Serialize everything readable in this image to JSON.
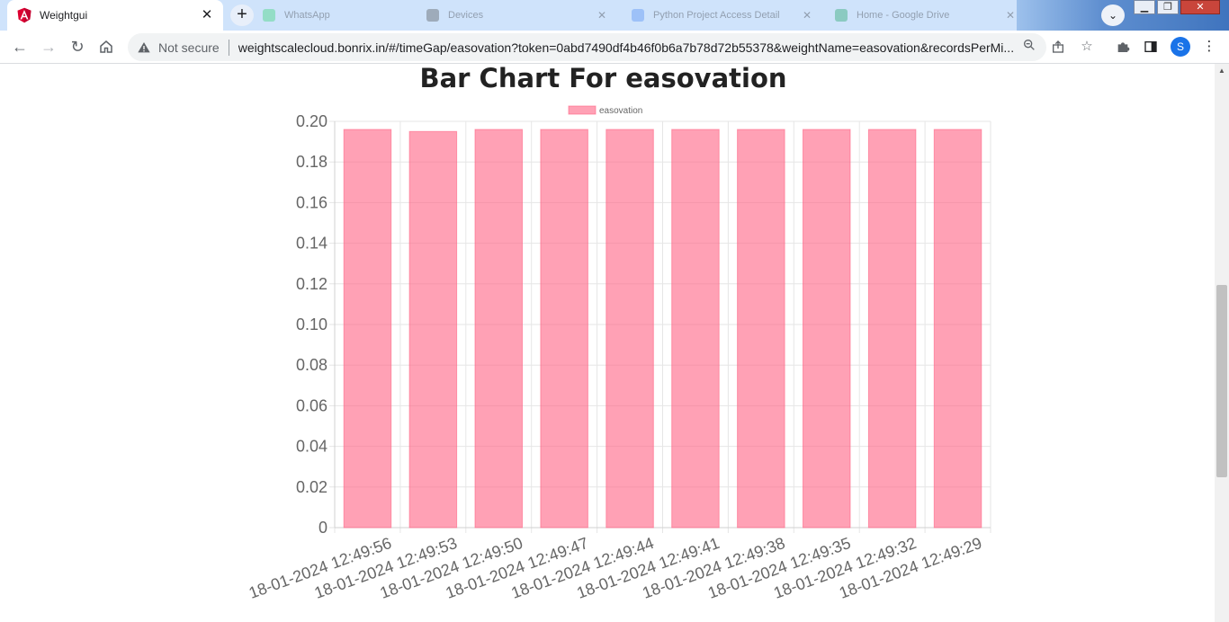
{
  "browser": {
    "active_tab": {
      "title": "Weightgui"
    },
    "background_tabs": [
      {
        "title": "WhatsApp",
        "favcolor": "#25d366"
      },
      {
        "title": "Devices",
        "favcolor": "#444444"
      },
      {
        "title": "Python Project Access Detail",
        "favcolor": "#4285f4"
      },
      {
        "title": "Home - Google Drive",
        "favcolor": "#0f9d58"
      }
    ],
    "security_label": "Not secure",
    "url": "weightscalecloud.bonrix.in/#/timeGap/easovation?token=0abd7490df4b46f0b6a7b78d72b55378&weightName=easovation&recordsPerMi...",
    "profile_initial": "S"
  },
  "chart_data": {
    "type": "bar",
    "title": "Bar Chart For easovation",
    "series": [
      {
        "name": "easovation",
        "color": "rgba(255,99,132,0.6)",
        "values": [
          0.196,
          0.195,
          0.196,
          0.196,
          0.196,
          0.196,
          0.196,
          0.196,
          0.196,
          0.196
        ]
      }
    ],
    "categories": [
      "18-01-2024 12:49:56",
      "18-01-2024 12:49:53",
      "18-01-2024 12:49:50",
      "18-01-2024 12:49:47",
      "18-01-2024 12:49:44",
      "18-01-2024 12:49:41",
      "18-01-2024 12:49:38",
      "18-01-2024 12:49:35",
      "18-01-2024 12:49:32",
      "18-01-2024 12:49:29"
    ],
    "ylim": [
      0,
      0.2
    ],
    "yticks": [
      "0",
      "0.02",
      "0.04",
      "0.06",
      "0.08",
      "0.10",
      "0.12",
      "0.14",
      "0.16",
      "0.18",
      "0.20"
    ],
    "legend_position": "top",
    "grid": true
  }
}
